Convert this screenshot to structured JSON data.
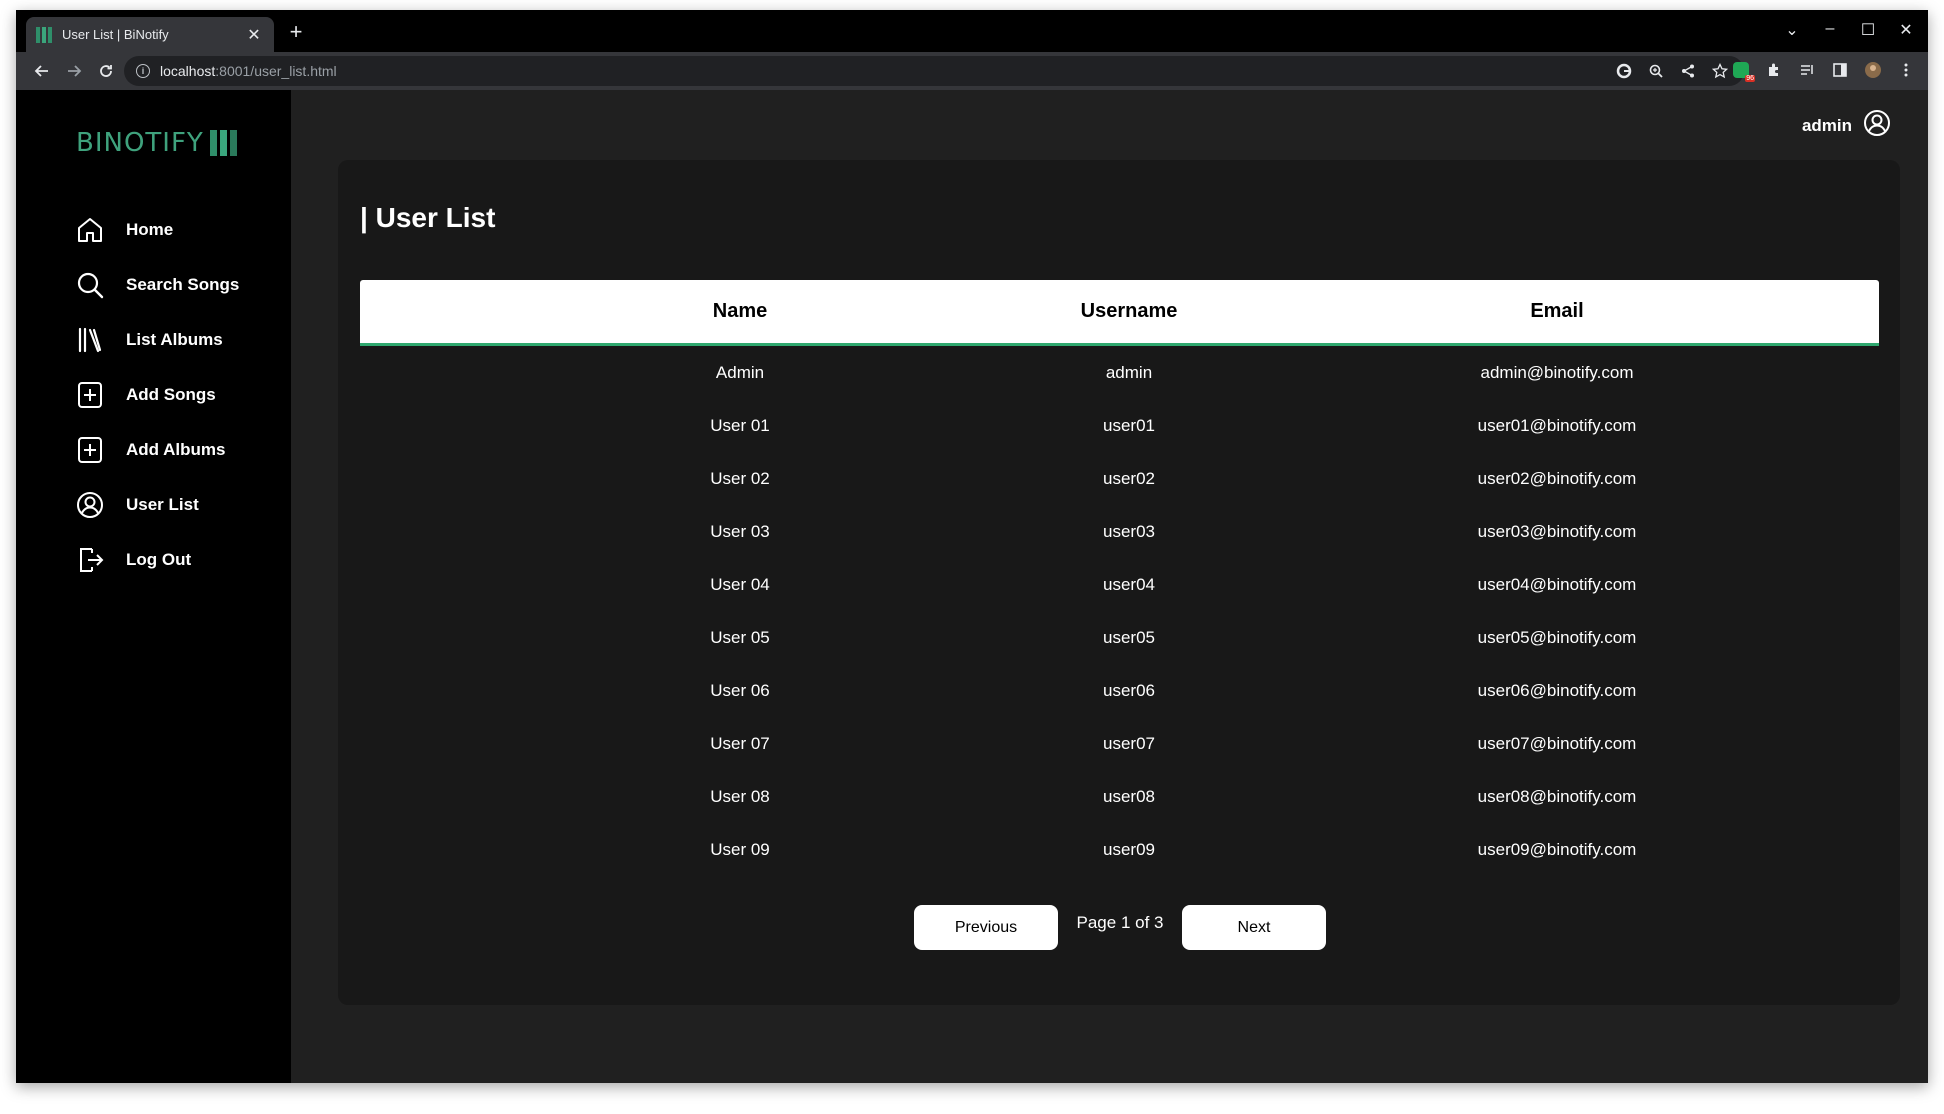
{
  "browser": {
    "tab_title": "User List | BiNotify",
    "url_host": "localhost",
    "url_rest": ":8001/user_list.html",
    "ext_badge": "96"
  },
  "sidebar": {
    "logo_text": "BINOTIFY",
    "items": [
      {
        "label": "Home",
        "icon": "home-icon"
      },
      {
        "label": "Search Songs",
        "icon": "search-icon"
      },
      {
        "label": "List Albums",
        "icon": "library-icon"
      },
      {
        "label": "Add Songs",
        "icon": "plus-square-icon"
      },
      {
        "label": "Add Albums",
        "icon": "plus-square-icon"
      },
      {
        "label": "User List",
        "icon": "user-circle-icon"
      },
      {
        "label": "Log Out",
        "icon": "logout-icon"
      }
    ]
  },
  "header": {
    "username": "admin"
  },
  "main": {
    "title": "| User List",
    "columns": [
      "Name",
      "Username",
      "Email"
    ],
    "rows": [
      [
        "Admin",
        "admin",
        "admin@binotify.com"
      ],
      [
        "User 01",
        "user01",
        "user01@binotify.com"
      ],
      [
        "User 02",
        "user02",
        "user02@binotify.com"
      ],
      [
        "User 03",
        "user03",
        "user03@binotify.com"
      ],
      [
        "User 04",
        "user04",
        "user04@binotify.com"
      ],
      [
        "User 05",
        "user05",
        "user05@binotify.com"
      ],
      [
        "User 06",
        "user06",
        "user06@binotify.com"
      ],
      [
        "User 07",
        "user07",
        "user07@binotify.com"
      ],
      [
        "User 08",
        "user08",
        "user08@binotify.com"
      ],
      [
        "User 09",
        "user09",
        "user09@binotify.com"
      ]
    ],
    "pagination": {
      "previous_label": "Previous",
      "page_info": "Page 1 of 3",
      "next_label": "Next"
    }
  },
  "colors": {
    "accent": "#2fa86f",
    "sidebar_bg": "#000000",
    "main_bg": "#202020",
    "card_bg": "#181818"
  }
}
